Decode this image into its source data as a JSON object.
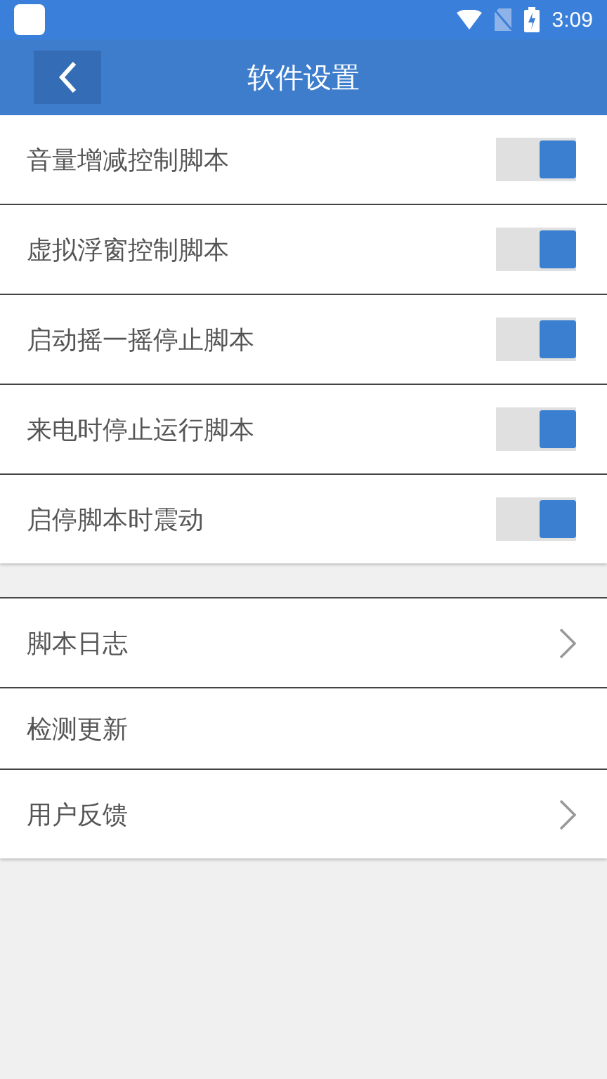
{
  "status_bar": {
    "time": "3:09"
  },
  "toolbar": {
    "title": "软件设置"
  },
  "toggles": [
    {
      "label": "音量增减控制脚本",
      "on": true
    },
    {
      "label": "虚拟浮窗控制脚本",
      "on": true
    },
    {
      "label": "启动摇一摇停止脚本",
      "on": true
    },
    {
      "label": "来电时停止运行脚本",
      "on": true
    },
    {
      "label": "启停脚本时震动",
      "on": true
    }
  ],
  "links": [
    {
      "label": "脚本日志",
      "has_arrow": true
    },
    {
      "label": "检测更新",
      "has_arrow": false
    },
    {
      "label": "用户反馈",
      "has_arrow": true
    }
  ]
}
